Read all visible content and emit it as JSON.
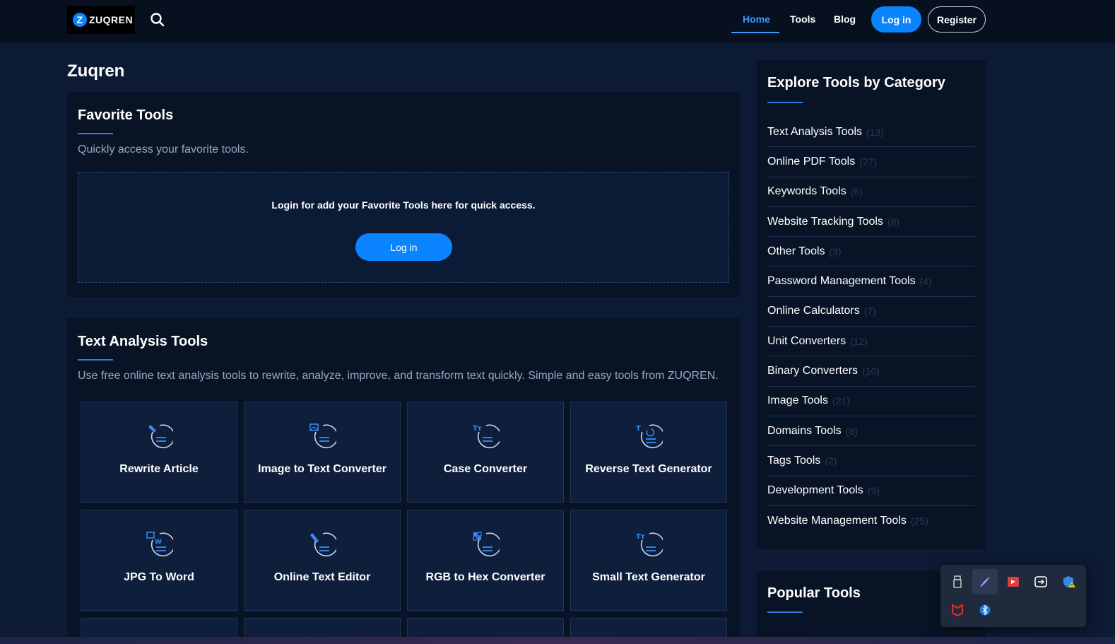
{
  "header": {
    "logo_text": "ZUQREN",
    "nav": {
      "home": "Home",
      "tools": "Tools",
      "blog": "Blog"
    },
    "login_label": "Log in",
    "register_label": "Register"
  },
  "main": {
    "page_title": "Zuqren",
    "favorites": {
      "title": "Favorite Tools",
      "description": "Quickly access your favorite tools.",
      "message": "Login for add your Favorite Tools here for quick access.",
      "login_label": "Log in"
    },
    "text_analysis": {
      "title": "Text Analysis Tools",
      "description": "Use free online text analysis tools to rewrite, analyze, improve, and transform text quickly. Simple and easy tools from ZUQREN.",
      "tools": [
        {
          "name": "Rewrite Article",
          "icon": "rewrite-icon"
        },
        {
          "name": "Image to Text Converter",
          "icon": "image-to-text-icon"
        },
        {
          "name": "Case Converter",
          "icon": "case-converter-icon"
        },
        {
          "name": "Reverse Text Generator",
          "icon": "reverse-text-icon"
        },
        {
          "name": "JPG To Word",
          "icon": "jpg-to-word-icon"
        },
        {
          "name": "Online Text Editor",
          "icon": "text-editor-icon"
        },
        {
          "name": "RGB to Hex Converter",
          "icon": "rgb-hex-icon"
        },
        {
          "name": "Small Text Generator",
          "icon": "small-text-icon"
        }
      ]
    }
  },
  "sidebar": {
    "categories_title": "Explore Tools by Category",
    "categories": [
      {
        "name": "Text Analysis Tools",
        "count": "(13)"
      },
      {
        "name": "Online PDF Tools",
        "count": "(27)"
      },
      {
        "name": "Keywords Tools",
        "count": "(6)"
      },
      {
        "name": "Website Tracking Tools",
        "count": "(8)"
      },
      {
        "name": "Other Tools",
        "count": "(3)"
      },
      {
        "name": "Password Management Tools",
        "count": "(4)"
      },
      {
        "name": "Online Calculators",
        "count": "(7)"
      },
      {
        "name": "Unit Converters",
        "count": "(12)"
      },
      {
        "name": "Binary Converters",
        "count": "(10)"
      },
      {
        "name": "Image Tools",
        "count": "(21)"
      },
      {
        "name": "Domains Tools",
        "count": "(8)"
      },
      {
        "name": "Tags Tools",
        "count": "(2)"
      },
      {
        "name": "Development Tools",
        "count": "(9)"
      },
      {
        "name": "Website Management Tools",
        "count": "(25)"
      }
    ],
    "popular_title": "Popular Tools"
  },
  "tray": {
    "icons": [
      "usb-drive-icon",
      "pen-icon",
      "video-recorder-icon",
      "remote-link-icon",
      "security-shield-icon",
      "mcafee-icon",
      "bluetooth-icon"
    ]
  },
  "colors": {
    "accent": "#0a84ff",
    "background": "#0d1a33",
    "panel": "#081426",
    "card": "#0e1e3b"
  }
}
